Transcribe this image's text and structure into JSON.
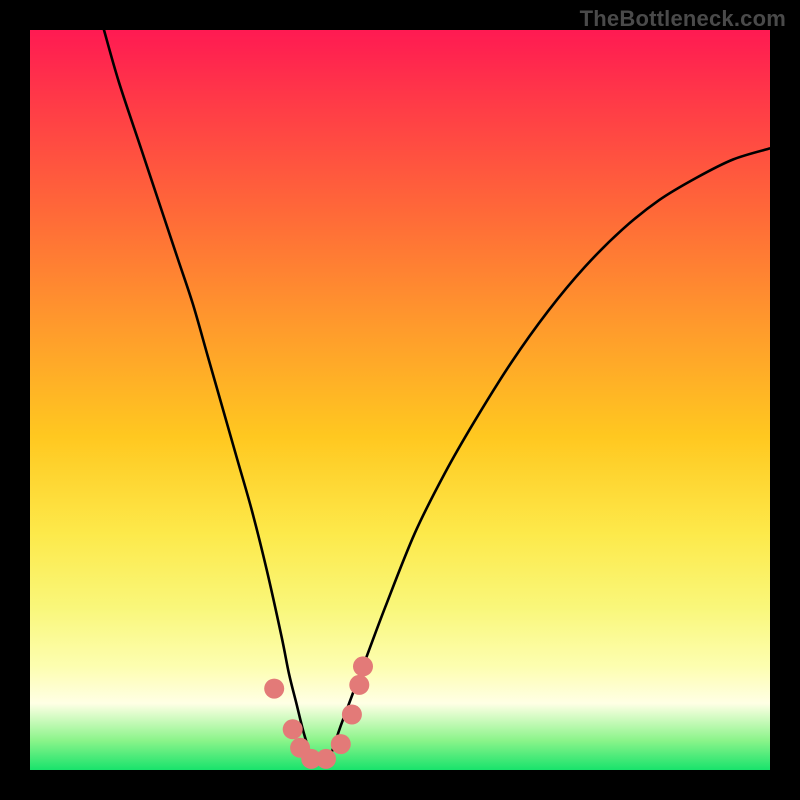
{
  "watermark": "TheBottleneck.com",
  "chart_data": {
    "type": "line",
    "title": "",
    "xlabel": "",
    "ylabel": "",
    "xlim": [
      0,
      100
    ],
    "ylim": [
      0,
      100
    ],
    "series": [
      {
        "name": "curve",
        "color": "#000000",
        "x": [
          10,
          12,
          15,
          18,
          20,
          22,
          24,
          26,
          28,
          30,
          32,
          34,
          35,
          36,
          37,
          38,
          39,
          40,
          41,
          42,
          45,
          48,
          52,
          56,
          60,
          65,
          70,
          75,
          80,
          85,
          90,
          95,
          100
        ],
        "y": [
          100,
          93,
          84,
          75,
          69,
          63,
          56,
          49,
          42,
          35,
          27,
          18,
          13,
          9,
          5,
          2,
          1,
          1,
          3,
          6,
          14,
          22,
          32,
          40,
          47,
          55,
          62,
          68,
          73,
          77,
          80,
          82.5,
          84
        ]
      }
    ],
    "markers": [
      {
        "x": 33.0,
        "y": 11.0
      },
      {
        "x": 35.5,
        "y": 5.5
      },
      {
        "x": 36.5,
        "y": 3.0
      },
      {
        "x": 38.0,
        "y": 1.5
      },
      {
        "x": 40.0,
        "y": 1.5
      },
      {
        "x": 42.0,
        "y": 3.5
      },
      {
        "x": 43.5,
        "y": 7.5
      },
      {
        "x": 44.5,
        "y": 11.5
      },
      {
        "x": 45.0,
        "y": 14.0
      }
    ],
    "marker_color": "#e37a78",
    "gradient_stops": [
      {
        "pos": 0.0,
        "color": "#ff1a52"
      },
      {
        "pos": 0.25,
        "color": "#ff6a38"
      },
      {
        "pos": 0.55,
        "color": "#ffc820"
      },
      {
        "pos": 0.8,
        "color": "#fdfeb0"
      },
      {
        "pos": 0.96,
        "color": "#8bf48a"
      },
      {
        "pos": 1.0,
        "color": "#18e36c"
      }
    ]
  }
}
